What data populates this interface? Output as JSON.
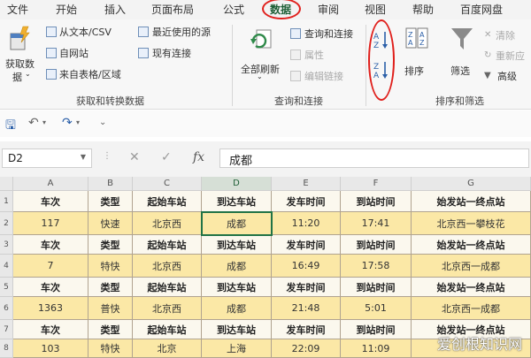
{
  "menu": {
    "tabs": [
      "文件",
      "开始",
      "插入",
      "页面布局",
      "公式",
      "数据",
      "审阅",
      "视图",
      "帮助",
      "百度网盘"
    ],
    "active": "数据"
  },
  "ribbon": {
    "get_data": {
      "label_line1": "获取数",
      "label_line2": "据",
      "from_text": "从文本/CSV",
      "from_web": "自网站",
      "from_table": "来自表格/区域",
      "recent_sources": "最近使用的源",
      "existing_connections": "现有连接",
      "group_label": "获取和转换数据"
    },
    "queries": {
      "refresh_all": "全部刷新",
      "queries_connections": "查询和连接",
      "properties": "属性",
      "edit_links": "编辑链接",
      "group_label": "查询和连接"
    },
    "sort_filter": {
      "sort": "排序",
      "filter": "筛选",
      "clear": "清除",
      "reapply": "重新应",
      "advanced": "高级",
      "group_label": "排序和筛选"
    }
  },
  "formula_bar": {
    "name_box": "D2",
    "fx": "fx",
    "value": "成都"
  },
  "sheet": {
    "columns": [
      "A",
      "B",
      "C",
      "D",
      "E",
      "F",
      "G"
    ],
    "rows": [
      {
        "num": "1",
        "kind": "hdr",
        "cells": [
          "车次",
          "类型",
          "起始车站",
          "到达车站",
          "发车时间",
          "到站时间",
          "始发站一终点站"
        ]
      },
      {
        "num": "2",
        "kind": "val",
        "cells": [
          "117",
          "快速",
          "北京西",
          "成都",
          "11:20",
          "17:41",
          "北京西一攀枝花"
        ]
      },
      {
        "num": "3",
        "kind": "hdr",
        "cells": [
          "车次",
          "类型",
          "起始车站",
          "到达车站",
          "发车时间",
          "到站时间",
          "始发站一终点站"
        ]
      },
      {
        "num": "4",
        "kind": "val",
        "cells": [
          "7",
          "特快",
          "北京西",
          "成都",
          "16:49",
          "17:58",
          "北京西一成都"
        ]
      },
      {
        "num": "5",
        "kind": "hdr",
        "cells": [
          "车次",
          "类型",
          "起始车站",
          "到达车站",
          "发车时间",
          "到站时间",
          "始发站一终点站"
        ]
      },
      {
        "num": "6",
        "kind": "val",
        "cells": [
          "1363",
          "普快",
          "北京西",
          "成都",
          "21:48",
          "5:01",
          "北京西一成都"
        ]
      },
      {
        "num": "7",
        "kind": "hdr",
        "cells": [
          "车次",
          "类型",
          "起始车站",
          "到达车站",
          "发车时间",
          "到站时间",
          "始发站一终点站"
        ]
      },
      {
        "num": "8",
        "kind": "val",
        "cells": [
          "103",
          "特快",
          "北京",
          "上海",
          "22:09",
          "11:09",
          ""
        ]
      }
    ]
  },
  "watermark": "爱创根知识网",
  "colors": {
    "accent": "#217346",
    "annotation": "#e0201c",
    "value_fill": "#fbe8a6"
  }
}
